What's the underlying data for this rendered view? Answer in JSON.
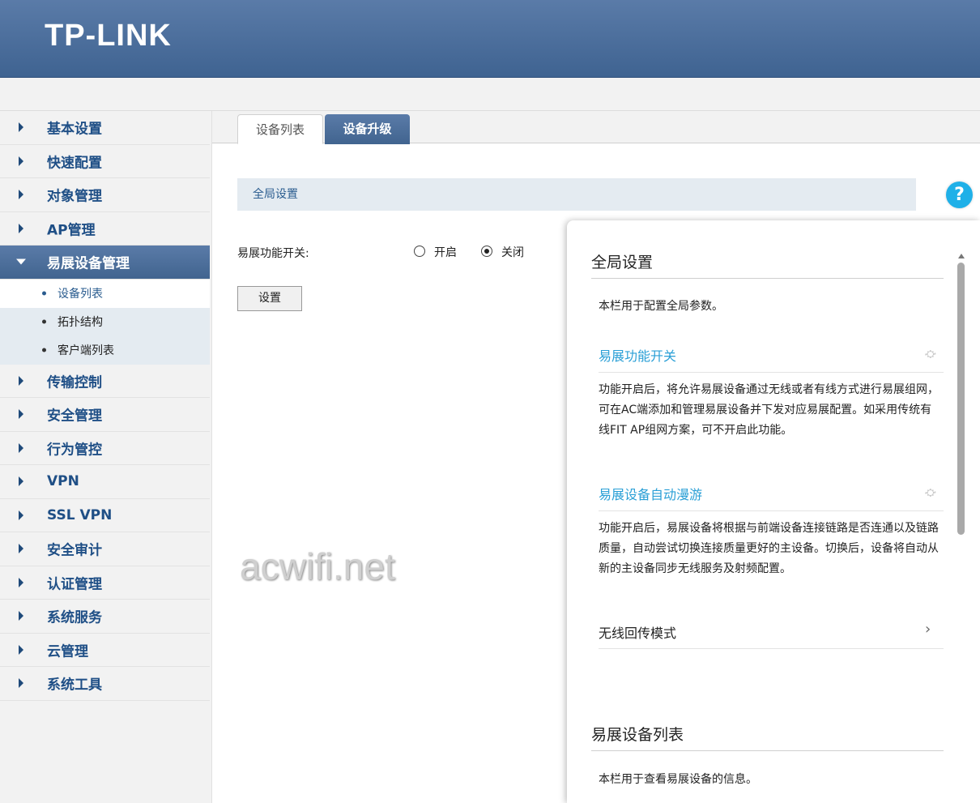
{
  "header": {
    "logo": "TP-LINK"
  },
  "sidebar": {
    "items": [
      {
        "label": "基本设置"
      },
      {
        "label": "快速配置"
      },
      {
        "label": "对象管理"
      },
      {
        "label": "AP管理"
      },
      {
        "label": "易展设备管理",
        "active": true,
        "children": [
          {
            "label": "设备列表",
            "active": true
          },
          {
            "label": "拓扑结构"
          },
          {
            "label": "客户端列表"
          }
        ]
      },
      {
        "label": "传输控制"
      },
      {
        "label": "安全管理"
      },
      {
        "label": "行为管控"
      },
      {
        "label": "VPN"
      },
      {
        "label": "SSL VPN"
      },
      {
        "label": "安全审计"
      },
      {
        "label": "认证管理"
      },
      {
        "label": "系统服务"
      },
      {
        "label": "云管理"
      },
      {
        "label": "系统工具"
      }
    ]
  },
  "tabs": [
    {
      "label": "设备列表"
    },
    {
      "label": "设备升级"
    }
  ],
  "main": {
    "section_title": "全局设置",
    "help_icon": "?",
    "switch_label": "易展功能开关:",
    "radio_on": "开启",
    "radio_off": "关闭",
    "selected": "关闭",
    "set_button": "设置"
  },
  "watermark": "acwifi.net",
  "help_panel": {
    "title1": "全局设置",
    "desc1": "本栏用于配置全局参数。",
    "sub1": "易展功能开关",
    "text1": "功能开启后，将允许易展设备通过无线或者有线方式进行易展组网，可在AC端添加和管理易展设备并下发对应易展配置。如采用传统有线FIT AP组网方案，可不开启此功能。",
    "sub2": "易展设备自动漫游",
    "text2": "功能开启后，易展设备将根据与前端设备连接链路是否连通以及链路质量，自动尝试切换连接质量更好的主设备。切换后，设备将自动从新的主设备同步无线服务及射频配置。",
    "row": "无线回传模式",
    "title2": "易展设备列表",
    "desc2": "本栏用于查看易展设备的信息。"
  },
  "colors": {
    "brand": "#41648f",
    "link": "#2a9fd6",
    "help": "#1fb0e8"
  },
  "icons": {
    "pin": "pin-icon",
    "chevron": "chevron-right-icon",
    "help": "help-icon"
  }
}
